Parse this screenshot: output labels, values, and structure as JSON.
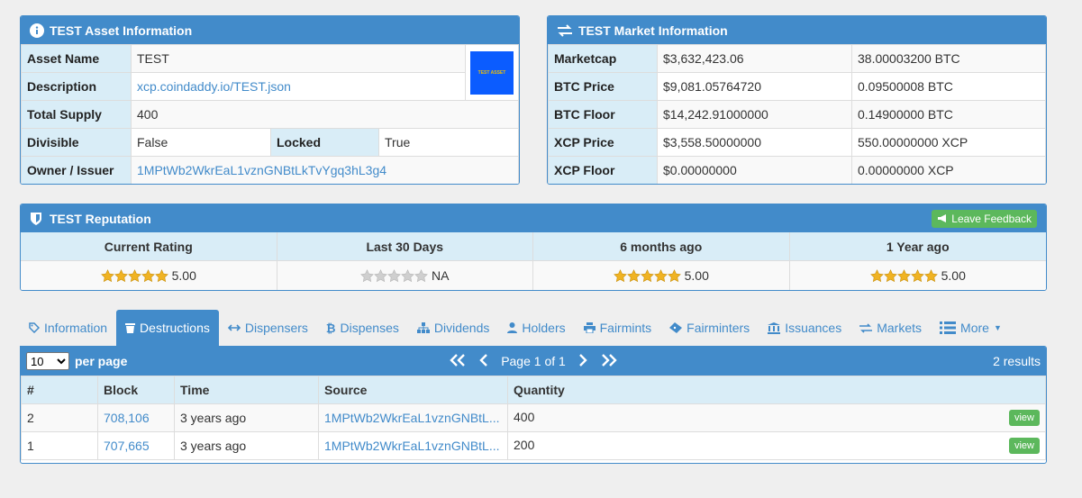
{
  "asset_panel": {
    "title": "TEST Asset Information",
    "asset_name_label": "Asset Name",
    "asset_name": "TEST",
    "description_label": "Description",
    "description": "xcp.coindaddy.io/TEST.json",
    "total_supply_label": "Total Supply",
    "total_supply": "400",
    "divisible_label": "Divisible",
    "divisible": "False",
    "locked_label": "Locked",
    "locked": "True",
    "owner_label": "Owner / Issuer",
    "owner": "1MPtWb2WkrEaL1vznGNBtLkTvYgq3hL3g4",
    "logo_text": "TEST ASSET"
  },
  "market_panel": {
    "title": "TEST Market Information",
    "rows": [
      {
        "label": "Marketcap",
        "usd": "$3,632,423.06",
        "alt": "38.00003200 BTC"
      },
      {
        "label": "BTC Price",
        "usd": "$9,081.05764720",
        "alt": "0.09500008 BTC"
      },
      {
        "label": "BTC Floor",
        "usd": "$14,242.91000000",
        "alt": "0.14900000 BTC"
      },
      {
        "label": "XCP Price",
        "usd": "$3,558.50000000",
        "alt": "550.00000000 XCP"
      },
      {
        "label": "XCP Floor",
        "usd": "$0.00000000",
        "alt": "0.00000000 XCP"
      }
    ]
  },
  "reputation": {
    "title": "TEST Reputation",
    "feedback_label": "Leave Feedback",
    "columns": [
      {
        "label": "Current Rating",
        "value": "5.00",
        "stars": 5
      },
      {
        "label": "Last 30 Days",
        "value": "NA",
        "stars": 0
      },
      {
        "label": "6 months ago",
        "value": "5.00",
        "stars": 5
      },
      {
        "label": "1 Year ago",
        "value": "5.00",
        "stars": 5
      }
    ]
  },
  "tabs": [
    {
      "label": "Information",
      "icon": "tag-icon"
    },
    {
      "label": "Destructions",
      "icon": "trash-icon"
    },
    {
      "label": "Dispensers",
      "icon": "arrows-h-icon"
    },
    {
      "label": "Dispenses",
      "icon": "bitcoin-icon"
    },
    {
      "label": "Dividends",
      "icon": "sitemap-icon"
    },
    {
      "label": "Holders",
      "icon": "user-icon"
    },
    {
      "label": "Fairmints",
      "icon": "print-icon"
    },
    {
      "label": "Fairminters",
      "icon": "ticket-icon"
    },
    {
      "label": "Issuances",
      "icon": "bank-icon"
    },
    {
      "label": "Markets",
      "icon": "exchange-icon"
    },
    {
      "label": "More",
      "icon": "list-icon"
    }
  ],
  "destructions": {
    "per_page_value": "10",
    "per_page_label": "per page",
    "page_label": "Page 1 of 1",
    "results": "2 results",
    "headers": [
      "#",
      "Block",
      "Time",
      "Source",
      "Quantity"
    ],
    "view_label": "view",
    "rows": [
      {
        "num": "2",
        "block": "708,106",
        "time": "3 years ago",
        "source": "1MPtWb2WkrEaL1vznGNBtL...",
        "quantity": "400"
      },
      {
        "num": "1",
        "block": "707,665",
        "time": "3 years ago",
        "source": "1MPtWb2WkrEaL1vznGNBtL...",
        "quantity": "200"
      }
    ]
  },
  "colors": {
    "primary": "#428bca",
    "label_bg": "#d9edf7",
    "success": "#5cb85c",
    "star": "#f0b323"
  }
}
